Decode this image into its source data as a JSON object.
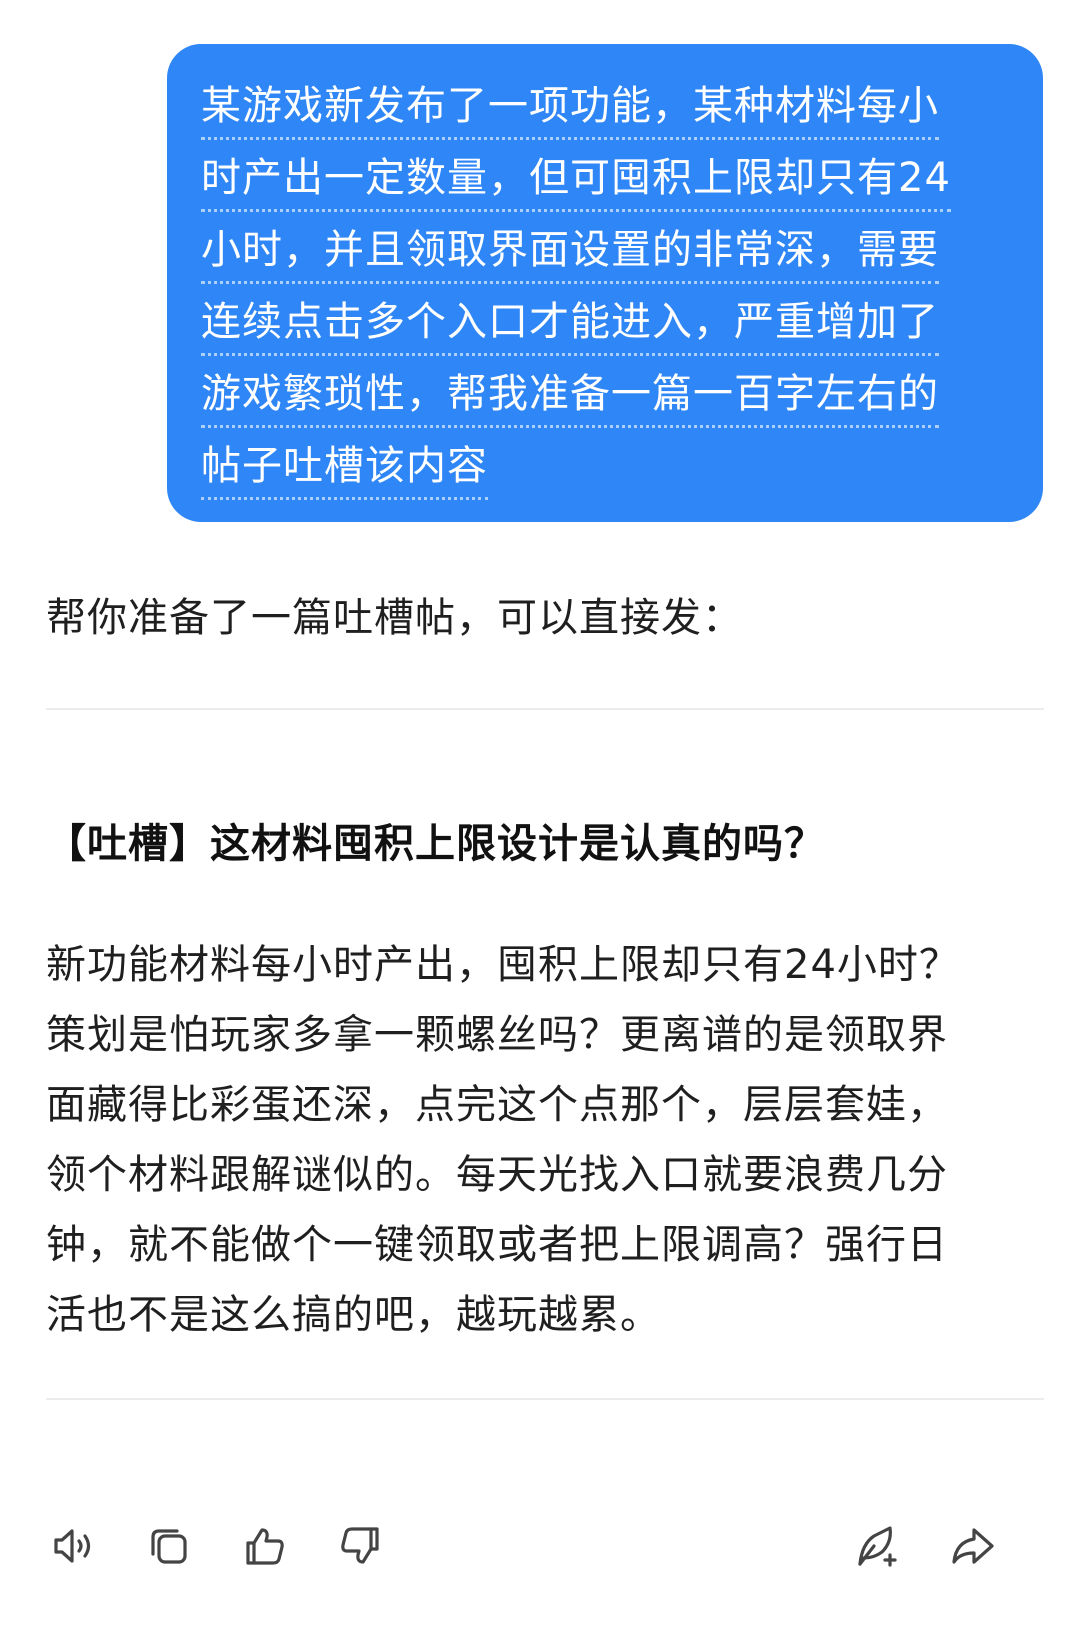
{
  "user_message": {
    "lines": [
      "某游戏新发布了一项功能，某种材料每小",
      "时产出一定数量，但可囤积上限却只有24",
      "小时，并且领取界面设置的非常深，需要",
      "连续点击多个入口才能进入，严重增加了",
      "游戏繁琐性，帮我准备一篇一百字左右的",
      "帖子吐槽该内容"
    ],
    "bubble_color": "#2f86f6"
  },
  "assistant": {
    "intro": "帮你准备了一篇吐槽帖，可以直接发：",
    "post_title": "【吐槽】这材料囤积上限设计是认真的吗？",
    "post_body_lines": [
      "新功能材料每小时产出，囤积上限却只有24小时？",
      "策划是怕玩家多拿一颗螺丝吗？更离谱的是领取界",
      "面藏得比彩蛋还深，点完这个点那个，层层套娃，",
      "领个材料跟解谜似的。每天光找入口就要浪费几分",
      "钟，就不能做个一键领取或者把上限调高？强行日",
      "活也不是这么搞的吧，越玩越累。"
    ]
  },
  "toolbar": {
    "icons": [
      "speaker-icon",
      "copy-icon",
      "thumbs-up-icon",
      "thumbs-down-icon",
      "edit-icon",
      "share-icon"
    ]
  }
}
